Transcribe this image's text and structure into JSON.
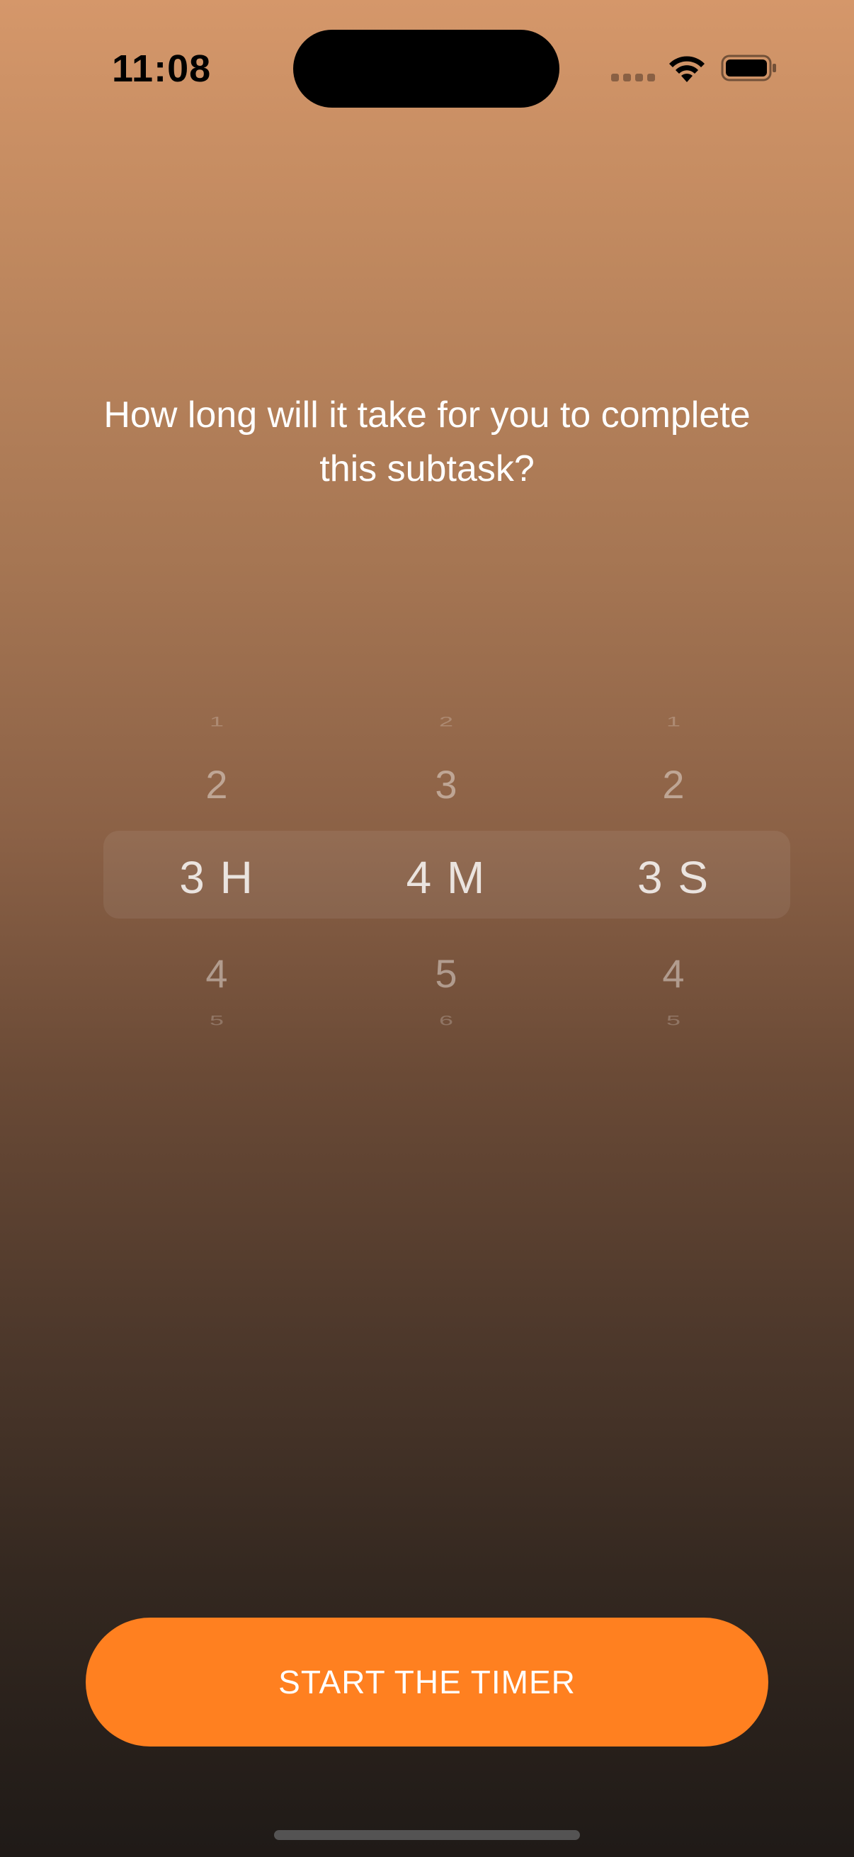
{
  "status_bar": {
    "time": "11:08",
    "icons": [
      "signal-icon",
      "wifi-icon",
      "battery-icon"
    ]
  },
  "prompt": {
    "question": "How long will it take for you to complete this subtask?"
  },
  "picker": {
    "hours": {
      "far_above": "1",
      "above": "2",
      "selected": "3 H",
      "below": "4",
      "far_below": "5"
    },
    "minutes": {
      "far_above": "2",
      "above": "3",
      "selected": "4 M",
      "below": "5",
      "far_below": "6"
    },
    "seconds": {
      "far_above": "1",
      "above": "2",
      "selected": "3 S",
      "below": "4",
      "far_below": "5"
    }
  },
  "actions": {
    "start_label": "START THE TIMER"
  },
  "colors": {
    "accent": "#ff8020",
    "gradient_top": "#d5976a",
    "gradient_bottom": "#1f1a17"
  }
}
